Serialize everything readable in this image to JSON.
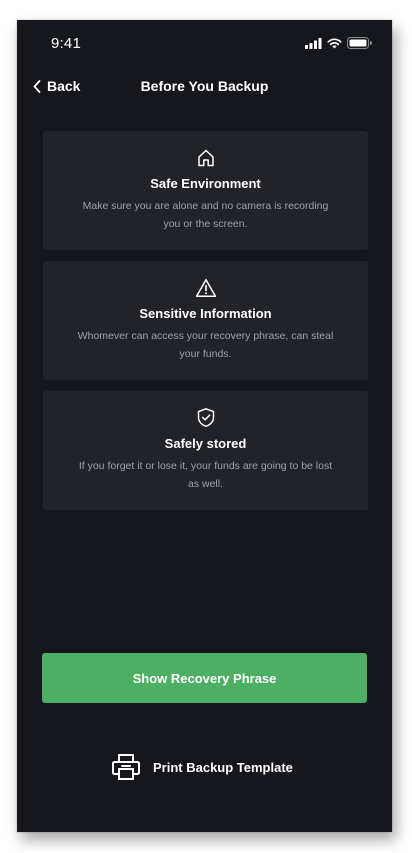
{
  "status_bar": {
    "time": "9:41",
    "icons": [
      "signal-icon",
      "wifi-icon",
      "battery-icon"
    ]
  },
  "nav": {
    "back_label": "Back",
    "title": "Before You Backup"
  },
  "cards": [
    {
      "icon": "home-icon",
      "title": "Safe Environment",
      "description": "Make sure you are alone and no camera is recording you or the screen."
    },
    {
      "icon": "warning-icon",
      "title": "Sensitive Information",
      "description": "Whomever can access your recovery phrase, can steal your funds."
    },
    {
      "icon": "shield-check-icon",
      "title": "Safely stored",
      "description": "If you forget it or lose it, your funds are going to be lost as well."
    }
  ],
  "actions": {
    "primary_label": "Show Recovery Phrase",
    "print_label": "Print Backup Template",
    "print_icon": "printer-icon"
  },
  "colors": {
    "background": "#15171c",
    "card": "#212328",
    "accent": "#4caf63",
    "muted_text": "#9ea1a8"
  }
}
